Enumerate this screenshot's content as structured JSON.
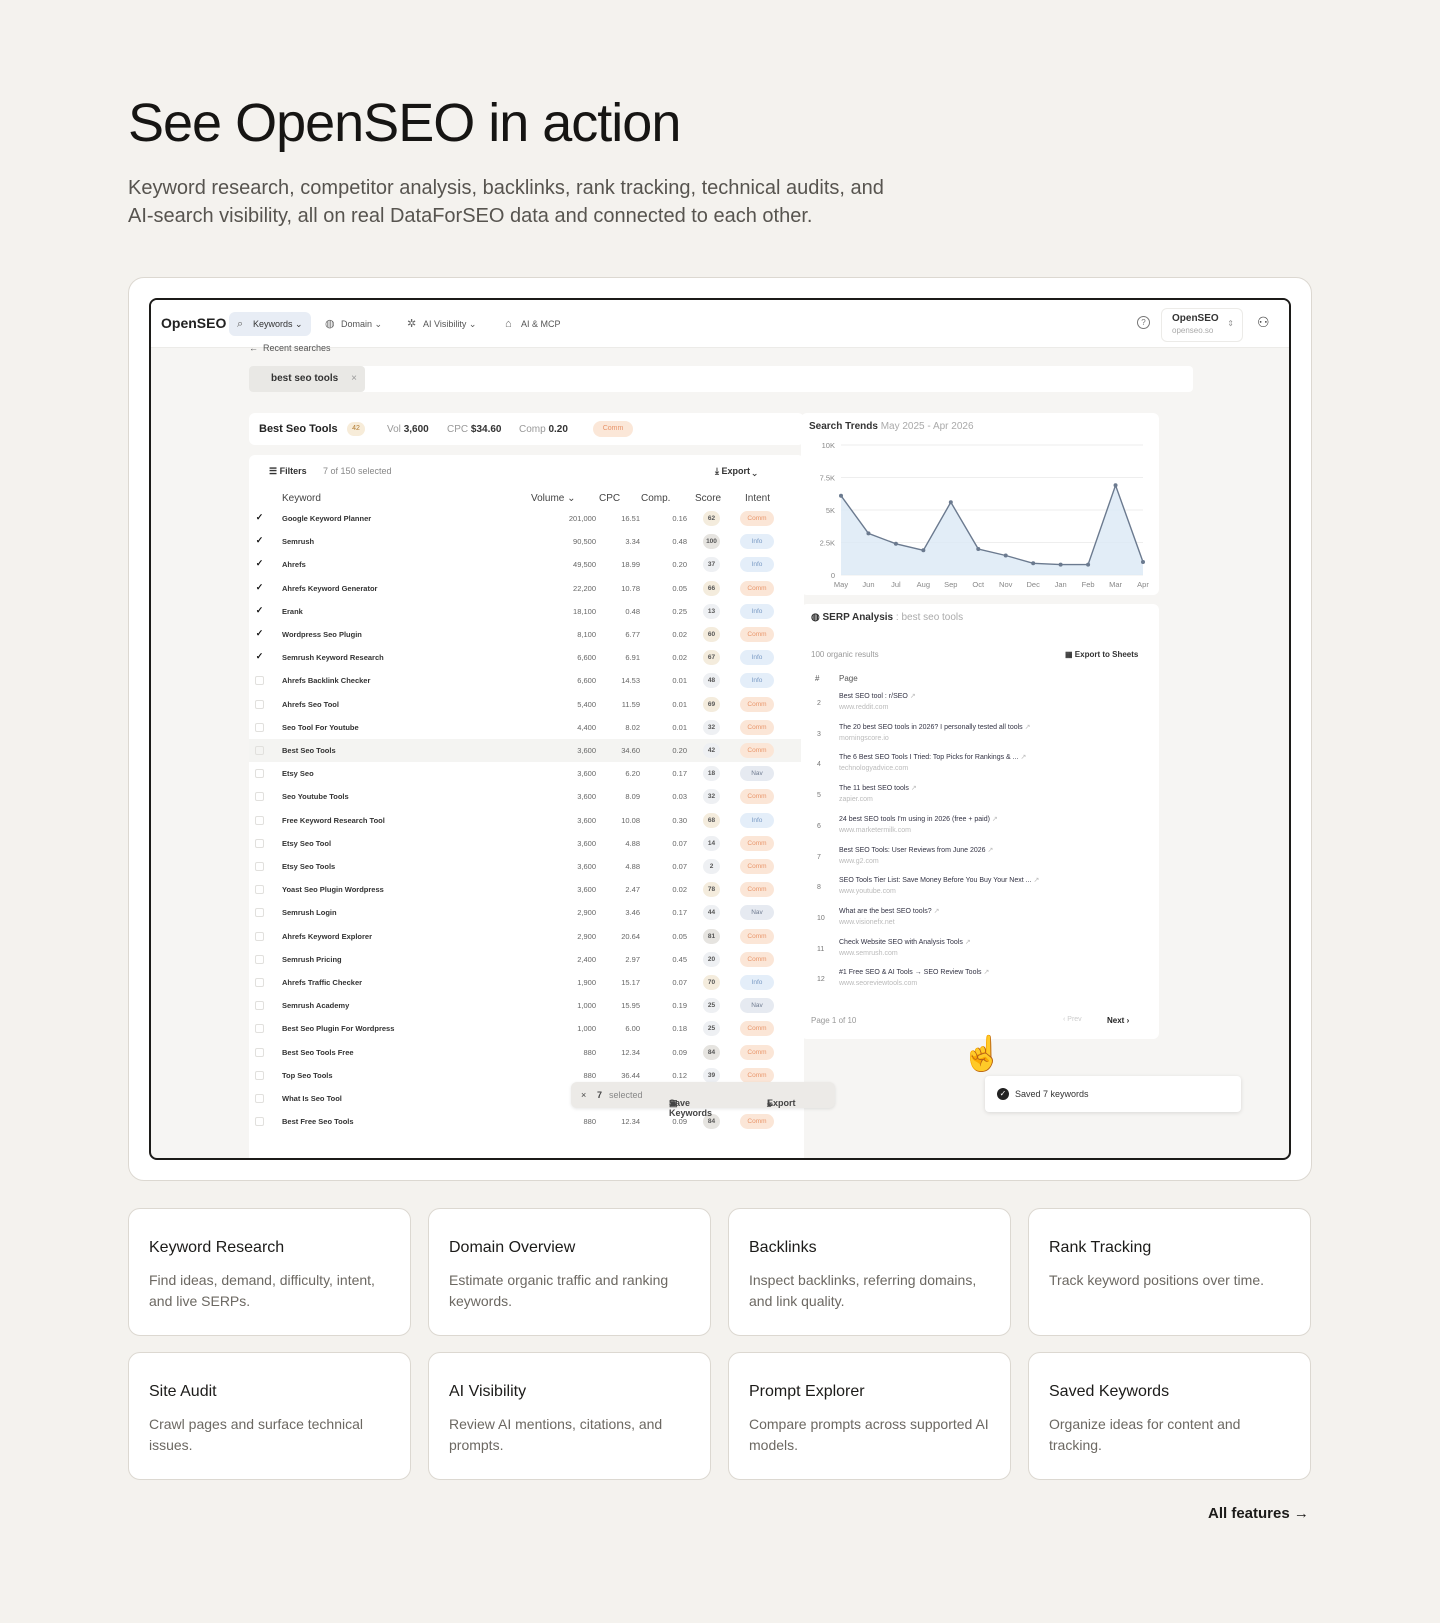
{
  "hero": {
    "title": "See OpenSEO in action",
    "subtitle": "Keyword research, competitor analysis, backlinks, rank tracking, technical audits, and AI-search visibility, all on real DataForSEO data and connected to each other."
  },
  "app": {
    "brand": "OpenSEO",
    "nav": [
      {
        "label": "Keywords",
        "icon": "search-icon"
      },
      {
        "label": "Domain",
        "icon": "globe-icon"
      },
      {
        "label": "AI Visibility",
        "icon": "sparkle-icon"
      },
      {
        "label": "AI & MCP",
        "icon": "robot-icon"
      }
    ],
    "account": {
      "name": "OpenSEO",
      "url": "openseo.so"
    },
    "recent": "Recent searches",
    "search_chip": "best seo tools",
    "summary": {
      "title": "Best Seo Tools",
      "count": "42",
      "vol_label": "Vol",
      "vol": "3,600",
      "cpc_label": "CPC",
      "cpc": "$34.60",
      "comp_label": "Comp",
      "comp": "0.20",
      "intent": "Comm"
    },
    "table": {
      "filters": "Filters",
      "selected": "7 of 150 selected",
      "export": "Export",
      "headers": {
        "keyword": "Keyword",
        "volume": "Volume",
        "cpc": "CPC",
        "comp": "Comp.",
        "score": "Score",
        "intent": "Intent"
      },
      "rows": [
        {
          "kw": "Google Keyword Planner",
          "vol": "201,000",
          "cpc": "16.51",
          "comp": "0.16",
          "score": "62",
          "intent": "Comm",
          "checked": true
        },
        {
          "kw": "Semrush",
          "vol": "90,500",
          "cpc": "3.34",
          "comp": "0.48",
          "score": "100",
          "intent": "Info",
          "checked": true
        },
        {
          "kw": "Ahrefs",
          "vol": "49,500",
          "cpc": "18.99",
          "comp": "0.20",
          "score": "37",
          "intent": "Info",
          "checked": true
        },
        {
          "kw": "Ahrefs Keyword Generator",
          "vol": "22,200",
          "cpc": "10.78",
          "comp": "0.05",
          "score": "66",
          "intent": "Comm",
          "checked": true
        },
        {
          "kw": "Erank",
          "vol": "18,100",
          "cpc": "0.48",
          "comp": "0.25",
          "score": "13",
          "intent": "Info",
          "checked": true
        },
        {
          "kw": "Wordpress Seo Plugin",
          "vol": "8,100",
          "cpc": "6.77",
          "comp": "0.02",
          "score": "60",
          "intent": "Comm",
          "checked": true
        },
        {
          "kw": "Semrush Keyword Research",
          "vol": "6,600",
          "cpc": "6.91",
          "comp": "0.02",
          "score": "67",
          "intent": "Info",
          "checked": true
        },
        {
          "kw": "Ahrefs Backlink Checker",
          "vol": "6,600",
          "cpc": "14.53",
          "comp": "0.01",
          "score": "48",
          "intent": "Info",
          "checked": false
        },
        {
          "kw": "Ahrefs Seo Tool",
          "vol": "5,400",
          "cpc": "11.59",
          "comp": "0.01",
          "score": "69",
          "intent": "Comm",
          "checked": false
        },
        {
          "kw": "Seo Tool For Youtube",
          "vol": "4,400",
          "cpc": "8.02",
          "comp": "0.01",
          "score": "32",
          "intent": "Comm",
          "checked": false
        },
        {
          "kw": "Best Seo Tools",
          "vol": "3,600",
          "cpc": "34.60",
          "comp": "0.20",
          "score": "42",
          "intent": "Comm",
          "checked": false,
          "hl": true
        },
        {
          "kw": "Etsy Seo",
          "vol": "3,600",
          "cpc": "6.20",
          "comp": "0.17",
          "score": "18",
          "intent": "Nav",
          "checked": false
        },
        {
          "kw": "Seo Youtube Tools",
          "vol": "3,600",
          "cpc": "8.09",
          "comp": "0.03",
          "score": "32",
          "intent": "Comm",
          "checked": false
        },
        {
          "kw": "Free Keyword Research Tool",
          "vol": "3,600",
          "cpc": "10.08",
          "comp": "0.30",
          "score": "68",
          "intent": "Info",
          "checked": false
        },
        {
          "kw": "Etsy Seo Tool",
          "vol": "3,600",
          "cpc": "4.88",
          "comp": "0.07",
          "score": "14",
          "intent": "Comm",
          "checked": false
        },
        {
          "kw": "Etsy Seo Tools",
          "vol": "3,600",
          "cpc": "4.88",
          "comp": "0.07",
          "score": "2",
          "intent": "Comm",
          "checked": false
        },
        {
          "kw": "Yoast Seo Plugin Wordpress",
          "vol": "3,600",
          "cpc": "2.47",
          "comp": "0.02",
          "score": "78",
          "intent": "Comm",
          "checked": false
        },
        {
          "kw": "Semrush Login",
          "vol": "2,900",
          "cpc": "3.46",
          "comp": "0.17",
          "score": "44",
          "intent": "Nav",
          "checked": false
        },
        {
          "kw": "Ahrefs Keyword Explorer",
          "vol": "2,900",
          "cpc": "20.64",
          "comp": "0.05",
          "score": "81",
          "intent": "Comm",
          "checked": false
        },
        {
          "kw": "Semrush Pricing",
          "vol": "2,400",
          "cpc": "2.97",
          "comp": "0.45",
          "score": "20",
          "intent": "Comm",
          "checked": false
        },
        {
          "kw": "Ahrefs Traffic Checker",
          "vol": "1,900",
          "cpc": "15.17",
          "comp": "0.07",
          "score": "70",
          "intent": "Info",
          "checked": false
        },
        {
          "kw": "Semrush Academy",
          "vol": "1,000",
          "cpc": "15.95",
          "comp": "0.19",
          "score": "25",
          "intent": "Nav",
          "checked": false
        },
        {
          "kw": "Best Seo Plugin For Wordpress",
          "vol": "1,000",
          "cpc": "6.00",
          "comp": "0.18",
          "score": "25",
          "intent": "Comm",
          "checked": false
        },
        {
          "kw": "Best Seo Tools Free",
          "vol": "880",
          "cpc": "12.34",
          "comp": "0.09",
          "score": "84",
          "intent": "Comm",
          "checked": false
        },
        {
          "kw": "Top Seo Tools",
          "vol": "880",
          "cpc": "36.44",
          "comp": "0.12",
          "score": "39",
          "intent": "Comm",
          "checked": false
        },
        {
          "kw": "What Is Seo Tool",
          "vol": "88",
          "cpc": "",
          "comp": "",
          "score": "",
          "intent": "",
          "checked": false
        },
        {
          "kw": "Best Free Seo Tools",
          "vol": "880",
          "cpc": "12.34",
          "comp": "0.09",
          "score": "84",
          "intent": "Comm",
          "checked": false
        }
      ]
    },
    "selection_bar": {
      "count": "7",
      "selected": "selected",
      "save": "Save Keywords",
      "export": "Export"
    },
    "trend": {
      "title": "Search Trends",
      "range": "May 2025 - Apr 2026"
    },
    "serp": {
      "title": "SERP Analysis",
      "query": ": best seo tools",
      "count": "100 organic results",
      "export": "Export to Sheets",
      "col_rank": "#",
      "col_page": "Page",
      "results": [
        {
          "rank": "2",
          "title": "Best SEO tool : r/SEO",
          "url": "www.reddit.com"
        },
        {
          "rank": "3",
          "title": "The 20 best SEO tools in 2026? I personally tested all tools",
          "url": "morningscore.io"
        },
        {
          "rank": "4",
          "title": "The 6 Best SEO Tools I Tried: Top Picks for Rankings & ...",
          "url": "technologyadvice.com"
        },
        {
          "rank": "5",
          "title": "The 11 best SEO tools",
          "url": "zapier.com"
        },
        {
          "rank": "6",
          "title": "24 best SEO tools I'm using in 2026 (free + paid)",
          "url": "www.marketermilk.com"
        },
        {
          "rank": "7",
          "title": "Best SEO Tools: User Reviews from June 2026",
          "url": "www.g2.com"
        },
        {
          "rank": "8",
          "title": "SEO Tools Tier List: Save Money Before You Buy Your Next ...",
          "url": "www.youtube.com"
        },
        {
          "rank": "10",
          "title": "What are the best SEO tools?",
          "url": "www.visionefx.net"
        },
        {
          "rank": "11",
          "title": "Check Website SEO with Analysis Tools",
          "url": "www.semrush.com"
        },
        {
          "rank": "12",
          "title": "#1 Free SEO & AI Tools → SEO Review Tools",
          "url": "www.seoreviewtools.com"
        }
      ],
      "pager": "Page 1 of 10",
      "prev": "‹ Prev",
      "next": "Next"
    },
    "toast": "Saved 7 keywords"
  },
  "chart_data": {
    "type": "area",
    "title": "Search Trends",
    "subtitle": "May 2025 - Apr 2026",
    "categories": [
      "May",
      "Jun",
      "Jul",
      "Aug",
      "Sep",
      "Oct",
      "Nov",
      "Dec",
      "Jan",
      "Feb",
      "Mar",
      "Apr"
    ],
    "values": [
      6100,
      3200,
      2400,
      1900,
      5600,
      2000,
      1500,
      900,
      800,
      800,
      6900,
      1000
    ],
    "ytick_labels": [
      "0",
      "2.5K",
      "5K",
      "7.5K",
      "10K"
    ],
    "ylim": [
      0,
      10000
    ],
    "colors": {
      "line": "#6b7a8f",
      "fill": "#dbe8f5"
    }
  },
  "features": [
    {
      "title": "Keyword Research",
      "desc": "Find ideas, demand, difficulty, intent, and live SERPs."
    },
    {
      "title": "Domain Overview",
      "desc": "Estimate organic traffic and ranking keywords."
    },
    {
      "title": "Backlinks",
      "desc": "Inspect backlinks, referring domains, and link quality."
    },
    {
      "title": "Rank Tracking",
      "desc": "Track keyword positions over time."
    },
    {
      "title": "Site Audit",
      "desc": "Crawl pages and surface technical issues."
    },
    {
      "title": "AI Visibility",
      "desc": "Review AI mentions, citations, and prompts."
    },
    {
      "title": "Prompt Explorer",
      "desc": "Compare prompts across supported AI models."
    },
    {
      "title": "Saved Keywords",
      "desc": "Organize ideas for content and tracking."
    }
  ],
  "all_features": "All features →",
  "intent_colors": {
    "Comm": {
      "bg": "#fbe6d7",
      "fg": "#e9966b"
    },
    "Info": {
      "bg": "#e4eef9",
      "fg": "#7a9ac4"
    },
    "Nav": {
      "bg": "#e6eaf1",
      "fg": "#6f7b90"
    }
  }
}
